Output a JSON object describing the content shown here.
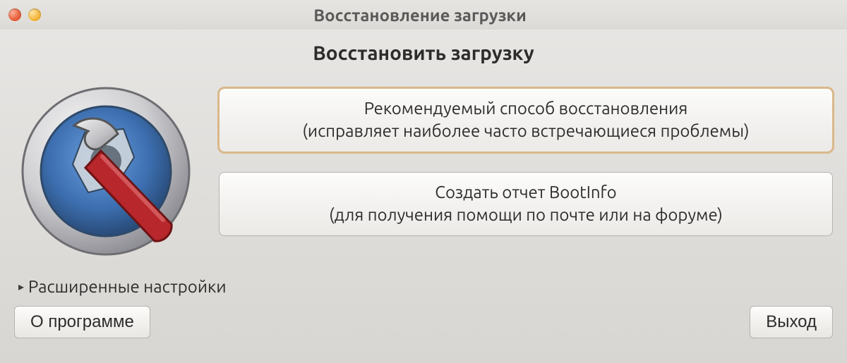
{
  "titlebar": {
    "title": "Восстановление загрузки"
  },
  "heading": "Восстановить загрузку",
  "buttons": {
    "recommended": {
      "line1": "Рекомендуемый способ восстановления",
      "line2": "(исправляет наиболее часто встречающиеся проблемы)"
    },
    "bootinfo": {
      "line1": "Создать отчет BootInfo",
      "line2": "(для получения помощи по почте или на форуме)"
    }
  },
  "expander": {
    "label": "Расширенные настройки"
  },
  "footer": {
    "about": "О программе",
    "exit": "Выход"
  }
}
